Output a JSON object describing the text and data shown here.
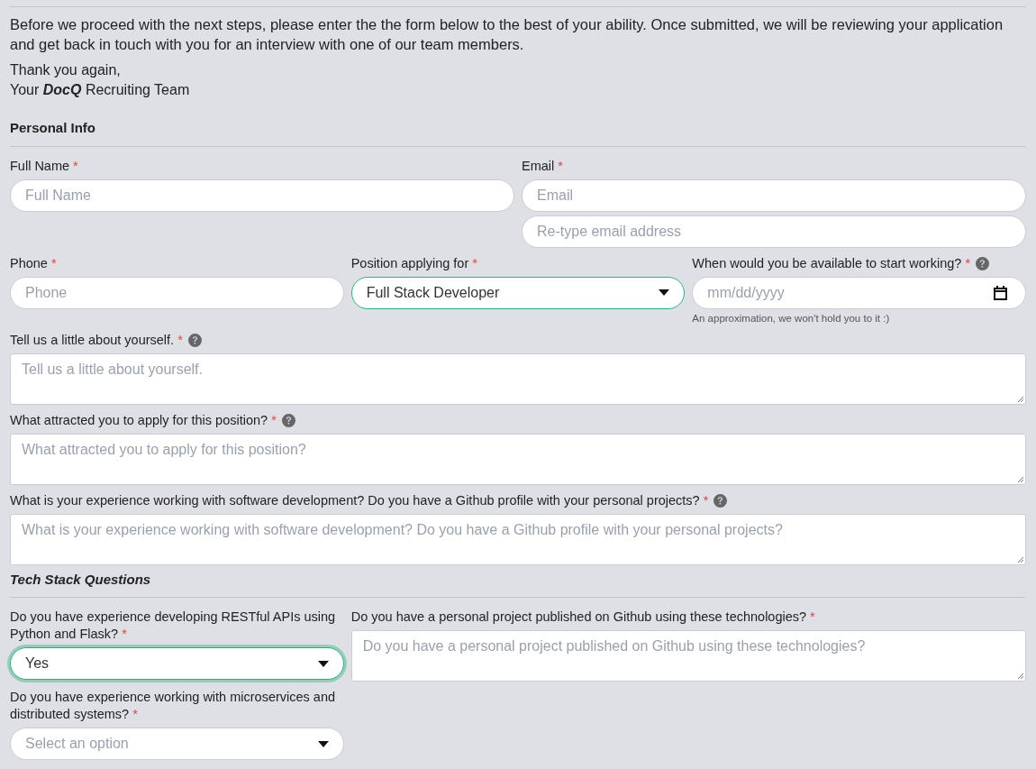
{
  "intro": {
    "paragraph": "Before we proceed with the next steps, please enter the the form below to the best of your ability. Once submitted, we will be reviewing your application and get back in touch with you for an interview with one of our team members.",
    "signoff": [
      "Thank you again,",
      "Your *DocQ* Recruiting Team"
    ]
  },
  "personal_info": {
    "title": "Personal Info",
    "rows": [
      [
        [
          {
            "label": "Full Name",
            "required_mark": "*",
            "inputs": [
              {
                "kind": "text",
                "placeholder": "Full Name",
                "highlighted": false,
                "focused": false
              }
            ]
          }
        ],
        [
          {
            "label": "Email",
            "required_mark": "*",
            "inputs": [
              {
                "kind": "text",
                "placeholder": "Email",
                "highlighted": false,
                "focused": false
              },
              {
                "kind": "text",
                "placeholder": "Re-type email address",
                "highlighted": false,
                "focused": false
              }
            ]
          }
        ]
      ],
      [
        [
          {
            "label": "Phone",
            "required_mark": "*",
            "inputs": [
              {
                "kind": "text",
                "placeholder": "Phone",
                "highlighted": false,
                "focused": false
              }
            ]
          }
        ],
        [
          {
            "label": "Position applying for",
            "required_mark": "*",
            "inputs": [
              {
                "kind": "select",
                "value": "Full Stack Developer",
                "highlighted": true,
                "focused": false
              }
            ]
          }
        ],
        [
          {
            "label": "When would you be available to start working?",
            "required_mark": "*",
            "help": true,
            "inputs": [
              {
                "kind": "date",
                "placeholder": "mm/dd/yyyy",
                "highlighted": false,
                "focused": false
              }
            ],
            "hint": "An approximation, we won't hold you to it :)"
          }
        ]
      ],
      [
        [
          {
            "label": "Tell us a little about yourself.",
            "required_mark": "*",
            "help": true,
            "inputs": [
              {
                "kind": "textarea",
                "placeholder": "Tell us a little about yourself.",
                "highlighted": false,
                "focused": false
              }
            ]
          }
        ]
      ],
      [
        [
          {
            "label": "What attracted you to apply for this position?",
            "required_mark": "*",
            "help": true,
            "inputs": [
              {
                "kind": "textarea",
                "placeholder": "What attracted you to apply for this position?",
                "highlighted": false,
                "focused": false
              }
            ]
          }
        ]
      ],
      [
        [
          {
            "label": "What is your experience working with software development? Do you have a Github profile with your personal projects?",
            "required_mark": "*",
            "help": true,
            "inputs": [
              {
                "kind": "textarea",
                "placeholder": "What is your experience working with software development? Do you have a Github profile with your personal projects?",
                "highlighted": false,
                "focused": false
              }
            ]
          }
        ]
      ]
    ]
  },
  "tech_stack": {
    "title": "Tech Stack Questions",
    "columns": [
      [
        {
          "label": "Do you have experience developing RESTful APIs using Python and Flask?",
          "required_mark": "*",
          "inputs": [
            {
              "kind": "select",
              "value": "Yes",
              "highlighted": true,
              "focused": true
            }
          ]
        },
        {
          "label": "Do you have experience working with microservices and distributed systems?",
          "required_mark": "*",
          "inputs": [
            {
              "kind": "select",
              "placeholder": "Select an option",
              "highlighted": false,
              "focused": false
            }
          ]
        }
      ],
      [
        {
          "label": "Do you have a personal project published on Github using these technologies?",
          "required_mark": "*",
          "inputs": [
            {
              "kind": "textarea",
              "placeholder": "Do you have a personal project published on Github using these technologies?",
              "highlighted": false,
              "focused": false
            }
          ]
        }
      ]
    ]
  }
}
